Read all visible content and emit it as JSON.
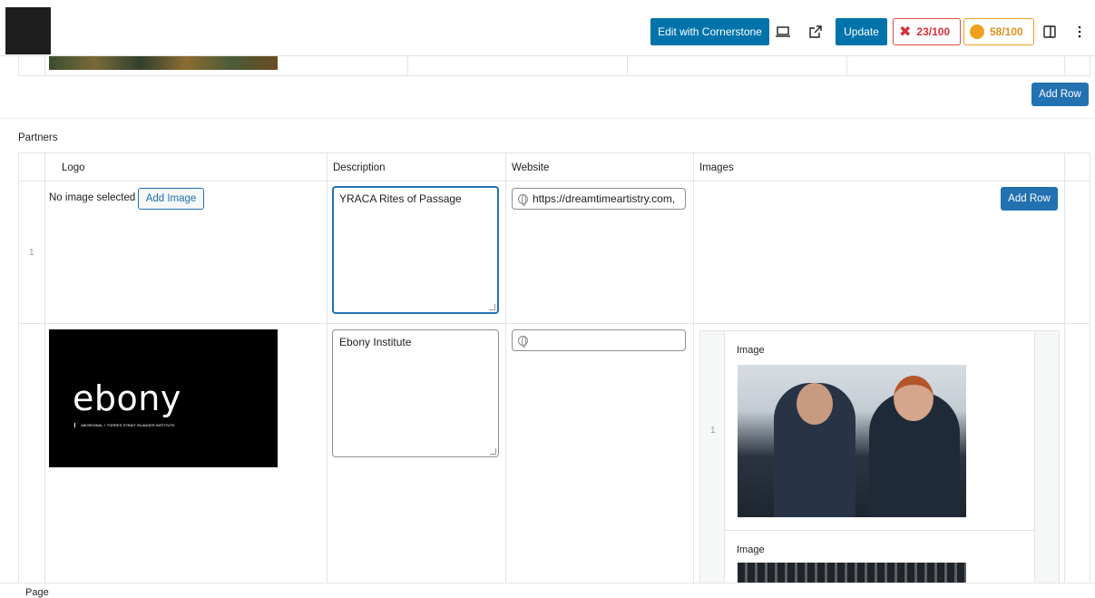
{
  "topbar": {
    "edit_button": "Edit with Cornerstone",
    "update_button": "Update",
    "score_red": "23/100",
    "score_orange": "58/100",
    "score_red_color": "#d9303b",
    "score_orange_color": "#e0901a"
  },
  "upper": {
    "add_row": "Add Row"
  },
  "partners": {
    "label": "Partners",
    "headers": [
      "Logo",
      "Description",
      "Website",
      "Images"
    ],
    "rows": [
      {
        "index": "1",
        "logo_status": "No image selected",
        "add_image": "Add Image",
        "description": "YRACA Rites of Passage",
        "website": "https://dreamtimeartistry.com,",
        "add_row": "Add Row"
      },
      {
        "logo_text": "ebony",
        "logo_subtext": "ABORIGINAL + TORRES STRAIT ISLANDER INSTITUTE",
        "description": "Ebony Institute",
        "website": "",
        "images": [
          {
            "index": "1",
            "label": "Image"
          },
          {
            "label": "Image"
          }
        ]
      }
    ]
  },
  "footer": {
    "label": "Page"
  }
}
